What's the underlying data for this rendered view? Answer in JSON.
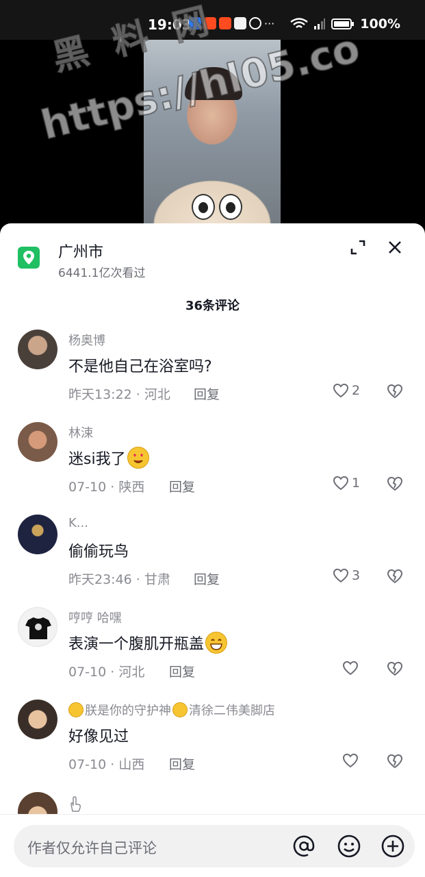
{
  "status_bar": {
    "time": "19:03",
    "battery": "100%"
  },
  "watermark": {
    "line1": "黑 料 网",
    "line2": "https://hl05.co"
  },
  "location": {
    "title": "广州市",
    "subtitle": "6441.1亿次看过"
  },
  "comments_count": "36条评论",
  "comments": [
    {
      "user": "杨奥博",
      "text": "不是他自己在浴室吗?",
      "time_place": "昨天13:22 · 河北",
      "reply": "回复",
      "likes": "2",
      "avatar_color": "#6b5f55"
    },
    {
      "user": "林涑",
      "text": "迷si我了",
      "time_place": "07-10 · 陕西",
      "reply": "回复",
      "likes": "1",
      "avatar_color": "#8a6a58"
    },
    {
      "user": "K...",
      "text": "偷偷玩鸟",
      "time_place": "昨天23:46 · 甘肃",
      "reply": "回复",
      "likes": "3",
      "avatar_color": "#1e2340"
    },
    {
      "user": "哼哼 哈嘿",
      "text": "表演一个腹肌开瓶盖",
      "time_place": "07-10 · 河北",
      "reply": "回复",
      "likes": "",
      "avatar_color": "#eeeeee"
    },
    {
      "user": "朕是你的守护神",
      "user_suffix": "清徐二伟美脚店",
      "text": "好像见过",
      "time_place": "07-10 · 山西",
      "reply": "回复",
      "likes": "",
      "avatar_color": "#c9a98a"
    }
  ],
  "input": {
    "placeholder": "作者仅允许自己评论"
  },
  "icons": {
    "location": "map-pin-icon",
    "expand": "expand-icon",
    "close": "close-icon",
    "like": "heart-icon",
    "dislike": "broken-heart-icon",
    "at": "at-icon",
    "emoji": "emoji-icon",
    "add": "plus-circle-icon"
  },
  "colors": {
    "location_icon": "#1fbf62",
    "text": "#161823",
    "secondary": "#8a8b91"
  }
}
